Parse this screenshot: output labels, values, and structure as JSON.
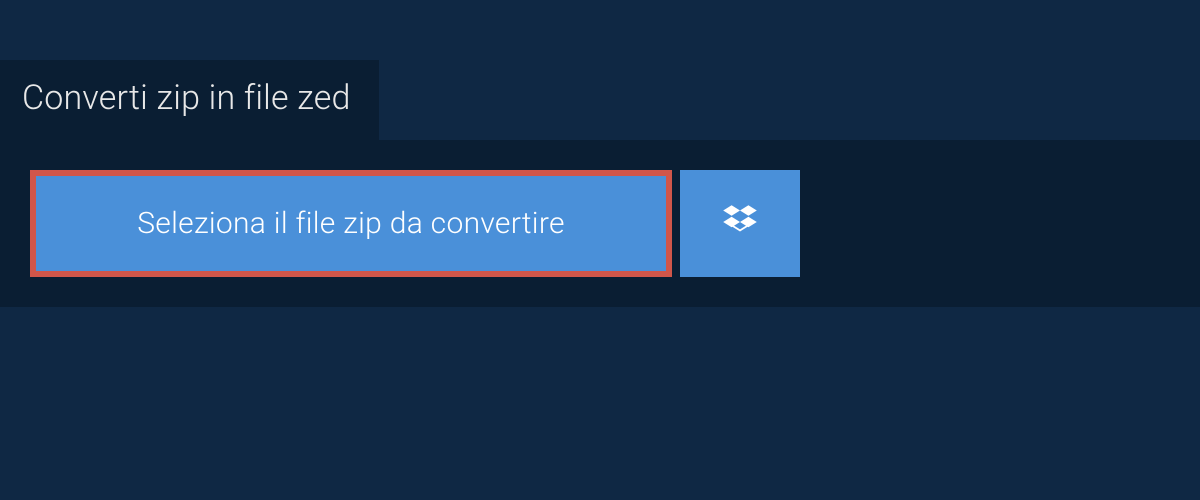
{
  "tab": {
    "title": "Converti zip in file zed"
  },
  "upload": {
    "select_label": "Seleziona il file zip da convertire"
  }
}
